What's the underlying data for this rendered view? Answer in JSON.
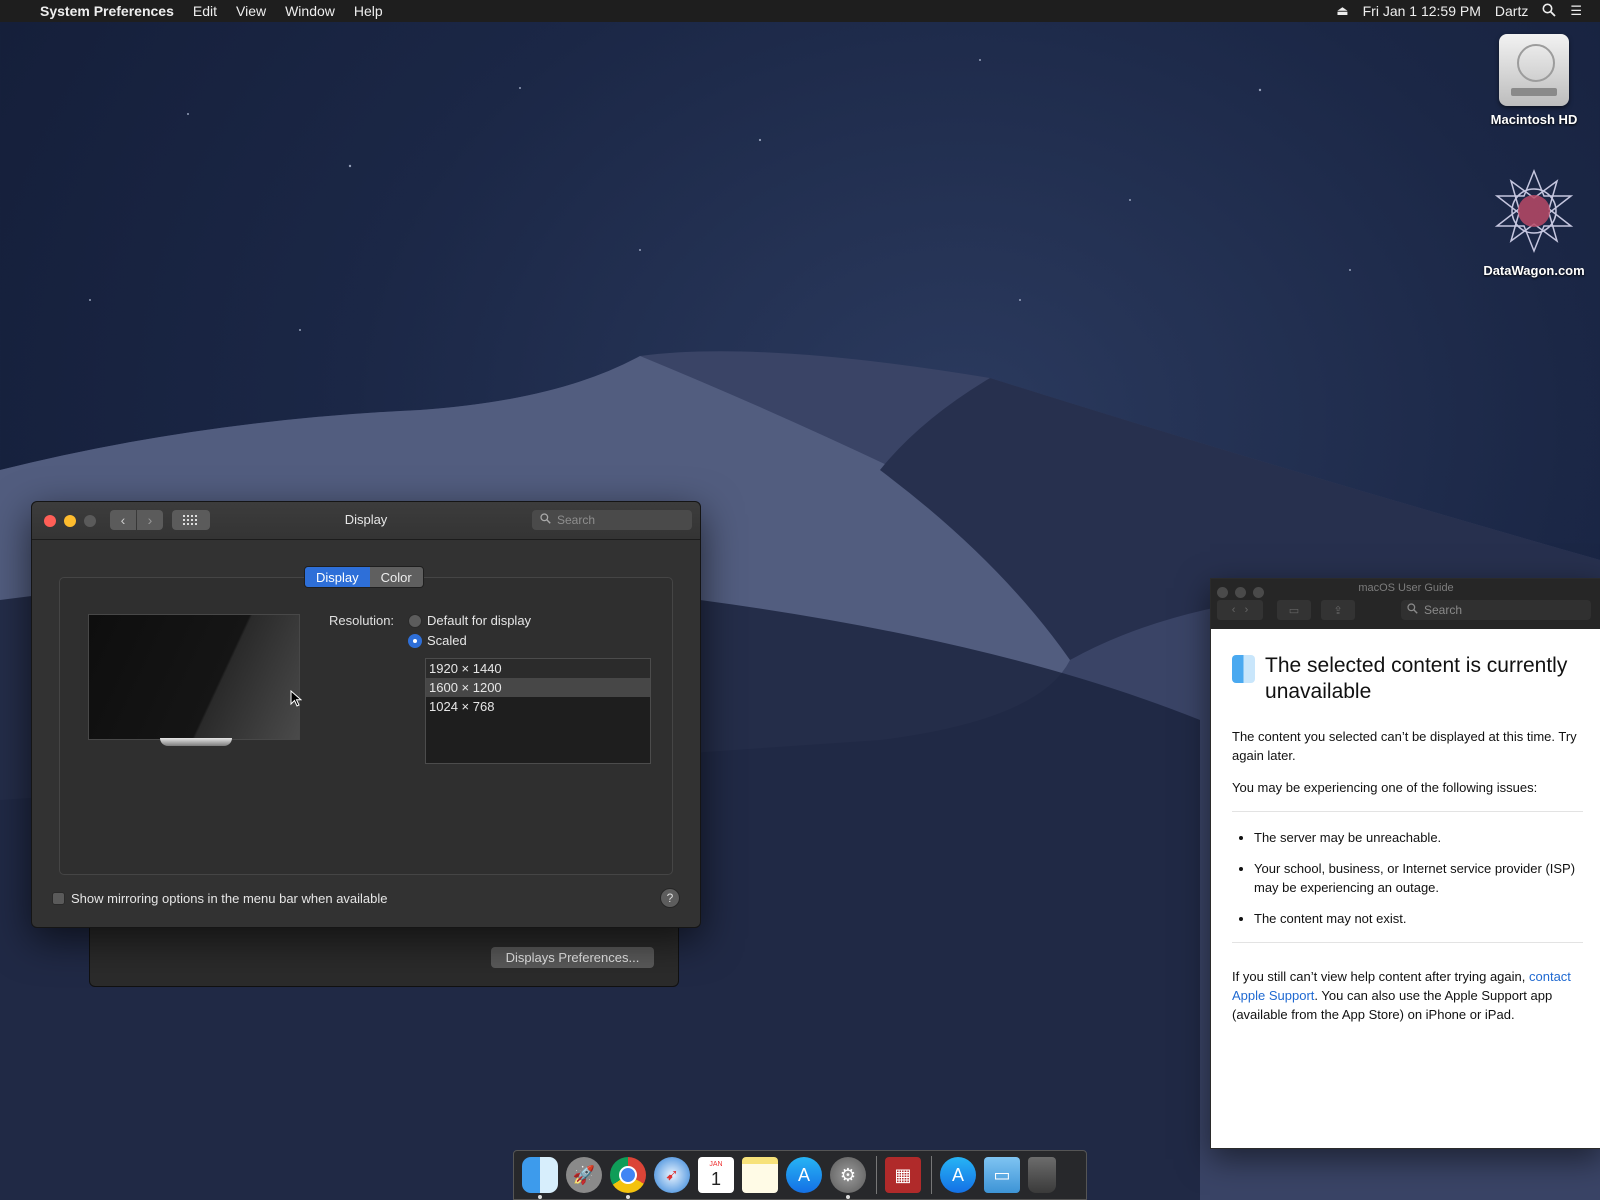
{
  "menubar": {
    "app_name": "System Preferences",
    "menus": [
      "Edit",
      "View",
      "Window",
      "Help"
    ],
    "datetime": "Fri Jan 1  12:59 PM",
    "user": "Dartz"
  },
  "desktop": {
    "icons": [
      {
        "label": "Macintosh HD",
        "icon": "hard-drive-icon"
      },
      {
        "label": "DataWagon.com",
        "icon": "datawagon-icon"
      }
    ]
  },
  "display_window": {
    "title": "Display",
    "search_placeholder": "Search",
    "tabs": [
      {
        "label": "Display",
        "active": true
      },
      {
        "label": "Color",
        "active": false
      }
    ],
    "resolution_label": "Resolution:",
    "options": [
      {
        "label": "Default for display",
        "selected": false
      },
      {
        "label": "Scaled",
        "selected": true
      }
    ],
    "resolutions": [
      "1920 × 1440",
      "1600 × 1200",
      "1024 × 768"
    ],
    "selected_resolution": "1600 × 1200",
    "mirroring_label": "Show mirroring options in the menu bar when available",
    "mirroring_checked": false,
    "help_label": "?",
    "displays_preferences_label": "Displays Preferences..."
  },
  "help_window": {
    "title": "macOS User Guide",
    "search_placeholder": "Search",
    "heading": "The selected content is currently unavailable",
    "para1": "The content you selected can’t be displayed at this time. Try again later.",
    "para2": "You may be experiencing one of the following issues:",
    "issues": [
      "The server may be unreachable.",
      "Your school, business, or Internet service provider (ISP) may be experiencing an outage.",
      "The content may not exist."
    ],
    "footer_before": "If you still can’t view help content after trying again, ",
    "footer_link": "contact Apple Support",
    "footer_after": ". You can also use the Apple Support app (available from the App Store) on iPhone or iPad."
  },
  "dock": {
    "items": [
      {
        "icon": "finder-icon",
        "running": true
      },
      {
        "icon": "launchpad-icon",
        "running": false
      },
      {
        "icon": "chrome-icon",
        "running": true
      },
      {
        "icon": "safari-icon",
        "running": false
      },
      {
        "icon": "calendar-icon",
        "running": false
      },
      {
        "icon": "notes-icon",
        "running": false
      },
      {
        "icon": "app-store-icon",
        "running": false
      },
      {
        "icon": "system-preferences-icon",
        "running": true
      },
      {
        "icon": "photo-booth-icon",
        "running": false
      },
      {
        "icon": "app-store-downloads-icon",
        "running": false
      },
      {
        "icon": "downloads-folder-icon",
        "running": false
      },
      {
        "icon": "trash-icon",
        "running": false
      }
    ],
    "calendar_month": "JAN",
    "calendar_day": "1"
  },
  "colors": {
    "accent": "#2e6fd8",
    "close": "#ff5f57",
    "minimize": "#febc2e",
    "link": "#1f69d1"
  }
}
